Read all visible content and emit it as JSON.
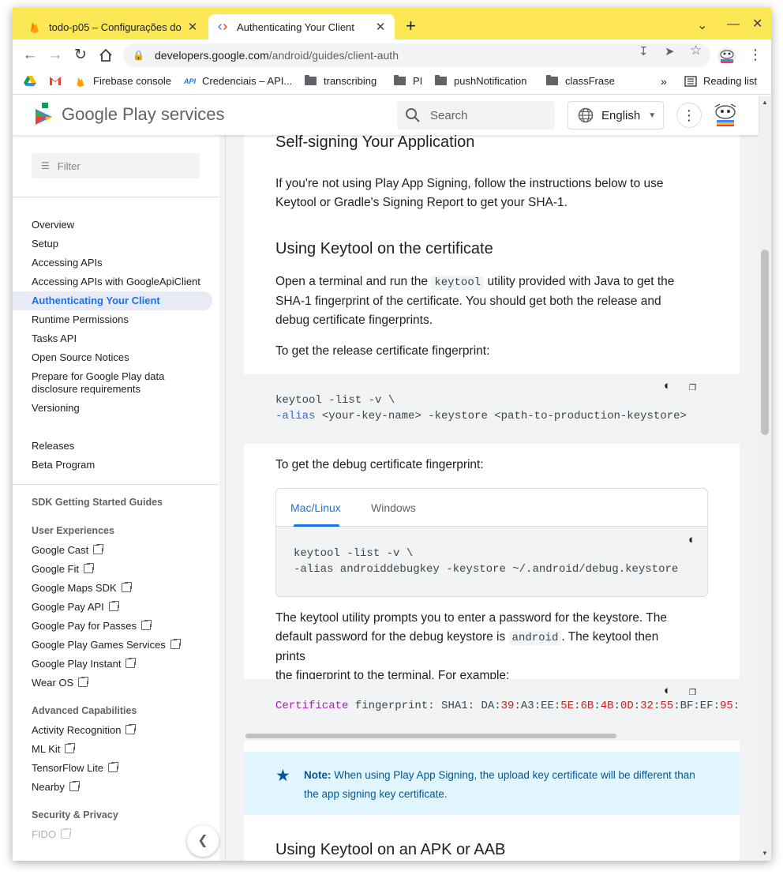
{
  "browser": {
    "tabs": [
      {
        "title": "todo-p05 – Configurações do",
        "close": "✕"
      },
      {
        "title": "Authenticating Your Client",
        "close": "✕"
      }
    ],
    "new_tab": "+",
    "url_host": "developers.google.com",
    "url_path": "/android/guides/client-auth",
    "bookmarks": [
      {
        "label": "Firebase console"
      },
      {
        "label": "Credenciais – API..."
      },
      {
        "label": "transcribing"
      },
      {
        "label": "PI"
      },
      {
        "label": "pushNotification"
      },
      {
        "label": "classFrase"
      }
    ],
    "bookmarks_more": "»",
    "reading_list": "Reading list",
    "api_badge": "API"
  },
  "site": {
    "brand_google": "Google",
    "brand_product": "Play services",
    "search_placeholder": "Search",
    "language": "English"
  },
  "sidebar": {
    "filter_placeholder": "Filter",
    "items": [
      "Overview",
      "Setup",
      "Accessing APIs",
      "Accessing APIs with GoogleApiClient",
      "Authenticating Your Client",
      "Runtime Permissions",
      "Tasks API",
      "Open Source Notices",
      "Prepare for Google Play data",
      "disclosure requirements",
      "Versioning",
      "Releases",
      "Beta Program"
    ],
    "headings": [
      "SDK Getting Started Guides",
      "User Experiences",
      "Advanced Capabilities",
      "Security & Privacy"
    ],
    "user_experiences": [
      "Google Cast",
      "Google Fit",
      "Google Maps SDK",
      "Google Pay API",
      "Google Pay for Passes",
      "Google Play Games Services",
      "Google Play Instant",
      "Wear OS"
    ],
    "advanced": [
      "Activity Recognition",
      "ML Kit",
      "TensorFlow Lite",
      "Nearby"
    ],
    "security": [
      "FIDO"
    ]
  },
  "article": {
    "h_self_signing": "Self-signing Your Application",
    "p_intro_1": "If you're not using Play App Signing, follow the instructions below to use",
    "p_intro_2": "Keytool or Gradle's Signing Report to get your SHA-1.",
    "h_keytool_cert": "Using Keytool on the certificate",
    "p_open_1a": "Open a terminal and run the",
    "code_keytool": "keytool",
    "p_open_1b": "utility provided with Java to get the",
    "p_open_2": "SHA-1 fingerprint of the certificate. You should get both the release and",
    "p_open_3": "debug certificate fingerprints.",
    "p_release": "To get the release certificate fingerprint:",
    "release_line1": "keytool -list -v \\",
    "release_line2_kw": "-alias",
    "release_line2_rest": " <your-key-name> -keystore <path-to-production-keystore>",
    "p_debug": "To get the debug certificate fingerprint:",
    "tab_mac": "Mac/Linux",
    "tab_windows": "Windows",
    "debug_line1": "keytool -list -v \\",
    "debug_line2": "-alias androiddebugkey -keystore ~/.android/debug.keystore",
    "p_prompt_1": "The keytool utility prompts you to enter a password for the keystore. The",
    "p_prompt_2a": "default password for the debug keystore is",
    "code_android": "android",
    "p_prompt_2b": ". The keytool then prints",
    "p_prompt_3": "the fingerprint to the terminal. For example:",
    "fp_kw": "Certificate",
    "fp_text": " fingerprint: SHA1: DA:",
    "fp_segments": [
      {
        "t": "39",
        "c": "num"
      },
      {
        "t": ":A3:EE:",
        "c": "txt"
      },
      {
        "t": "5E",
        "c": "num"
      },
      {
        "t": ":",
        "c": "txt"
      },
      {
        "t": "6B",
        "c": "num"
      },
      {
        "t": ":",
        "c": "txt"
      },
      {
        "t": "4B",
        "c": "num"
      },
      {
        "t": ":",
        "c": "txt"
      },
      {
        "t": "0D",
        "c": "num"
      },
      {
        "t": ":",
        "c": "txt"
      },
      {
        "t": "32",
        "c": "num"
      },
      {
        "t": ":",
        "c": "txt"
      },
      {
        "t": "55",
        "c": "num"
      },
      {
        "t": ":BF:EF:",
        "c": "txt"
      },
      {
        "t": "95",
        "c": "num"
      },
      {
        "t": ":",
        "c": "txt"
      }
    ],
    "note_label": "Note:",
    "note_text_1": " When using Play App Signing, the upload key certificate will be different than",
    "note_text_2": "the app signing key certificate.",
    "h_apk": "Using Keytool on an APK or AAB"
  }
}
